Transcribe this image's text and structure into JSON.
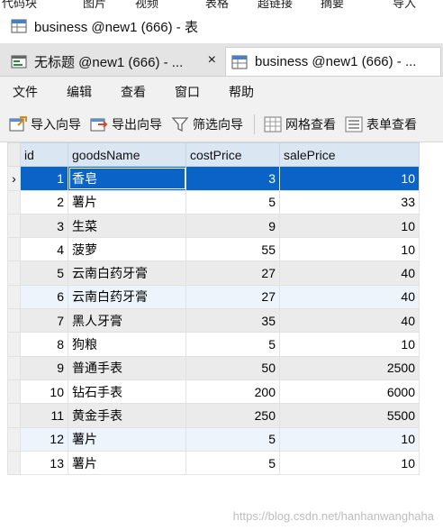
{
  "top_cut_menu": [
    "代码块",
    "图片",
    "视频",
    "表格",
    "超链接",
    "摘要",
    "导入"
  ],
  "window": {
    "title": "business @new1 (666) - 表"
  },
  "tabs": [
    {
      "label": "无标题 @new1 (666) - ...",
      "close": "×",
      "active": false
    },
    {
      "label": "business @new1 (666) - ...",
      "active": true
    }
  ],
  "menu": [
    "文件",
    "编辑",
    "查看",
    "窗口",
    "帮助"
  ],
  "toolbar": [
    {
      "label": "导入向导",
      "icon": "import-wizard-icon"
    },
    {
      "label": "导出向导",
      "icon": "export-wizard-icon"
    },
    {
      "label": "筛选向导",
      "icon": "filter-icon"
    },
    {
      "label": "网格查看",
      "icon": "grid-view-icon"
    },
    {
      "label": "表单查看",
      "icon": "form-view-icon"
    }
  ],
  "table": {
    "columns": [
      "id",
      "goodsName",
      "costPrice",
      "salePrice"
    ],
    "selected_row_marker": "›",
    "rows": [
      [
        "1",
        "香皂",
        "3",
        "10"
      ],
      [
        "2",
        "薯片",
        "5",
        "33"
      ],
      [
        "3",
        "生菜",
        "9",
        "10"
      ],
      [
        "4",
        "菠萝",
        "55",
        "10"
      ],
      [
        "5",
        "云南白药牙膏",
        "27",
        "40"
      ],
      [
        "6",
        "云南白药牙膏",
        "27",
        "40"
      ],
      [
        "7",
        "黑人牙膏",
        "35",
        "40"
      ],
      [
        "8",
        "狗粮",
        "5",
        "10"
      ],
      [
        "9",
        "普通手表",
        "50",
        "2500"
      ],
      [
        "10",
        "钻石手表",
        "200",
        "6000"
      ],
      [
        "11",
        "黄金手表",
        "250",
        "5500"
      ],
      [
        "12",
        "薯片",
        "5",
        "10"
      ],
      [
        "13",
        "薯片",
        "5",
        "10"
      ]
    ]
  },
  "watermark": "https://blog.csdn.net/hanhanwanghaha",
  "colors": {
    "selection": "#0a64c8",
    "header": "#dbe6f3",
    "alt_row": "#ebebeb"
  }
}
